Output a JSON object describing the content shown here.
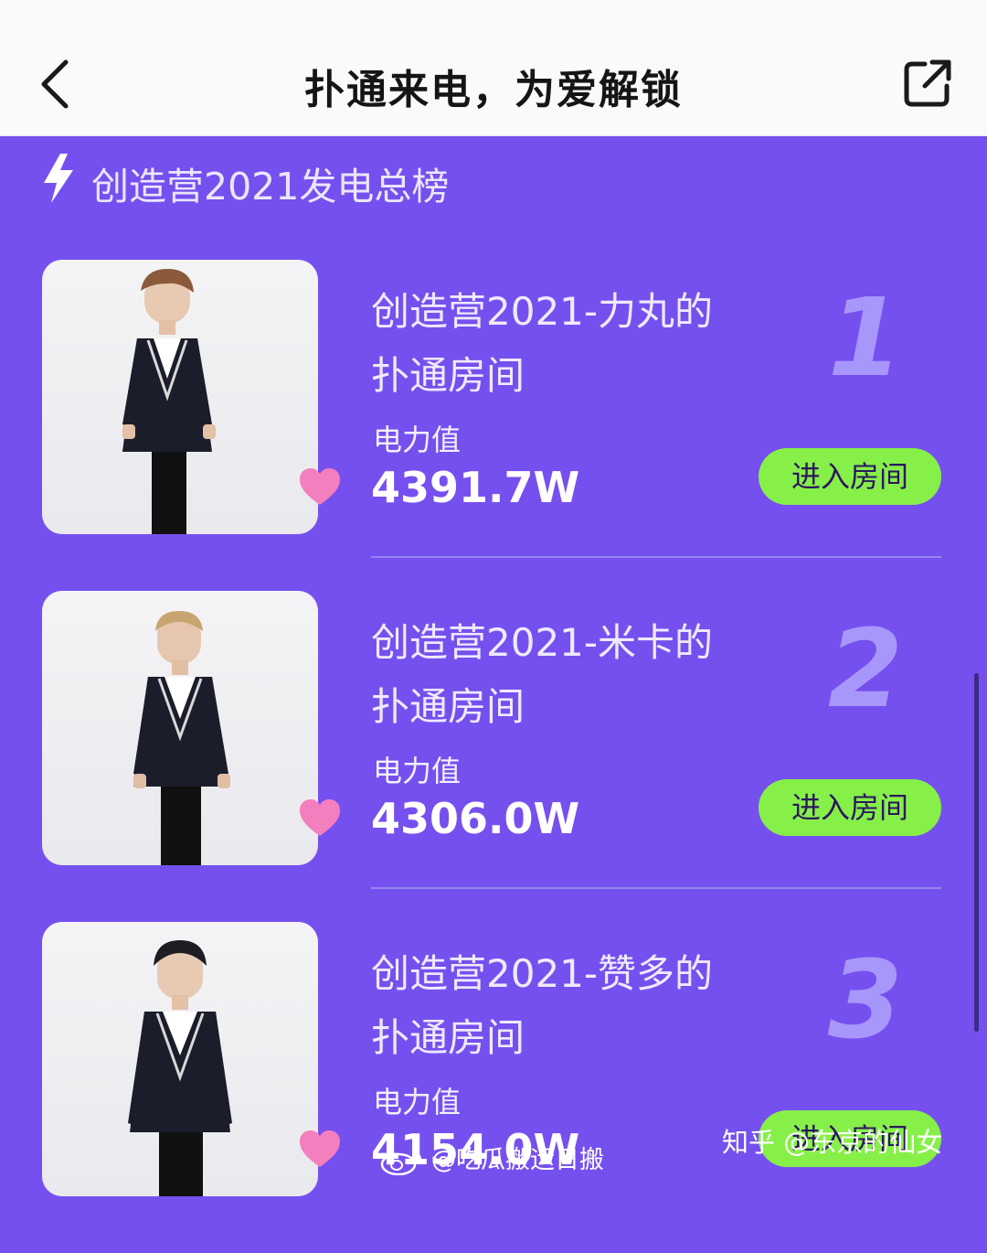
{
  "nav": {
    "title": "扑通来电，为爱解锁",
    "back_icon": "chevron-left-icon",
    "share_icon": "share-external-icon"
  },
  "section": {
    "icon": "lightning-icon",
    "title": "创造营2021发电总榜"
  },
  "rankings": [
    {
      "rank": "1",
      "name_line1": "创造营2021-力丸的",
      "name_line2": "扑通房间",
      "power_label": "电力值",
      "power_value": "4391.7W",
      "button": "进入房间"
    },
    {
      "rank": "2",
      "name_line1": "创造营2021-米卡的",
      "name_line2": "扑通房间",
      "power_label": "电力值",
      "power_value": "4306.0W",
      "button": "进入房间"
    },
    {
      "rank": "3",
      "name_line1": "创造营2021-赞多的",
      "name_line2": "扑通房间",
      "power_label": "电力值",
      "power_value": "4154.0W",
      "button": "进入房间"
    }
  ],
  "watermarks": {
    "weibo": "@吃瓜搬运日搬",
    "zhihu": "知乎 @东京的仙女"
  },
  "colors": {
    "background": "#7650ee",
    "button": "#86f048",
    "heart": "#f47fbe",
    "rank_number": "#a897fb"
  }
}
